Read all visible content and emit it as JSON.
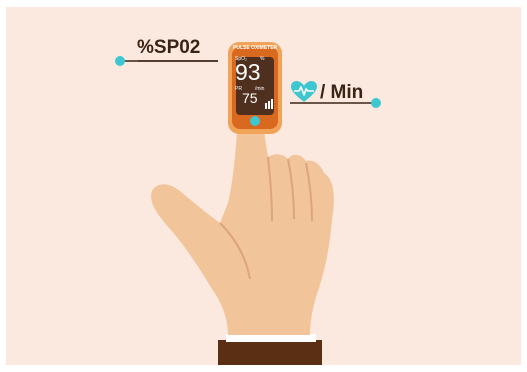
{
  "labels": {
    "spo2": "%SP02",
    "pulse_rate": "/ Min"
  },
  "device": {
    "title": "PULSE OXIMETER",
    "spo2_caption": "SpO₂",
    "percent_caption": "%",
    "spo2_value": "93",
    "pr_caption": "PR",
    "bpm_caption": "/min",
    "pulse_value": "75"
  },
  "icons": {
    "heart": "heart-pulse-icon",
    "power": "power-button-icon"
  },
  "colors": {
    "background": "#fbe9e0",
    "device_body": "#d9691f",
    "device_frame": "#f2a35a",
    "screen": "#4f2f1e",
    "screen_text": "#ffffff",
    "accent": "#3ec6d1",
    "label_text": "#3a2416",
    "skin": "#f1c49a",
    "skin_shadow": "#dca57b",
    "sleeve": "#5b2f14",
    "cuff": "#ffffff"
  }
}
